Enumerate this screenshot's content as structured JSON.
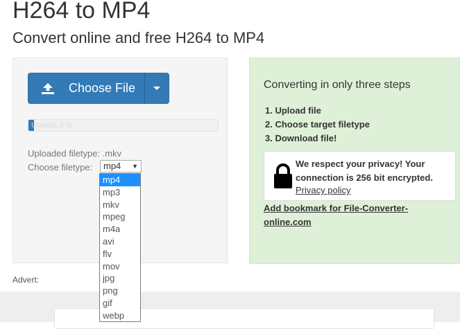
{
  "header": {
    "title": "H264 to MP4",
    "subtitle": "Convert online and free H264 to MP4"
  },
  "upload": {
    "choose_file_label": "Choose File",
    "progress_text": "Upload: 3 %",
    "progress_fraction": 0.03,
    "uploaded_filetype_text": "Uploaded filetype: .mkv",
    "choose_filetype_label": "Choose filetype:",
    "selected_format": "mp4",
    "arrow_glyph": "▼"
  },
  "formats": [
    "mp4",
    "mp3",
    "mkv",
    "mpeg",
    "m4a",
    "avi",
    "flv",
    "mov",
    "jpg",
    "png",
    "gif",
    "webp"
  ],
  "advert_label": "Advert:",
  "steps": {
    "title": "Converting in only three steps",
    "items": [
      "1. Upload file",
      "2. Choose target filetype",
      "3. Download file!"
    ]
  },
  "privacy": {
    "text": "We respect your privacy! Your connection is 256 bit encrypted.",
    "link_text": "Privacy policy"
  },
  "bookmark_text": "Add bookmark for File-Converter-online.com",
  "colors": {
    "primary": "#337ab7",
    "panel_green": "#dff0d8",
    "dropdown_selected": "#1e90ff"
  }
}
